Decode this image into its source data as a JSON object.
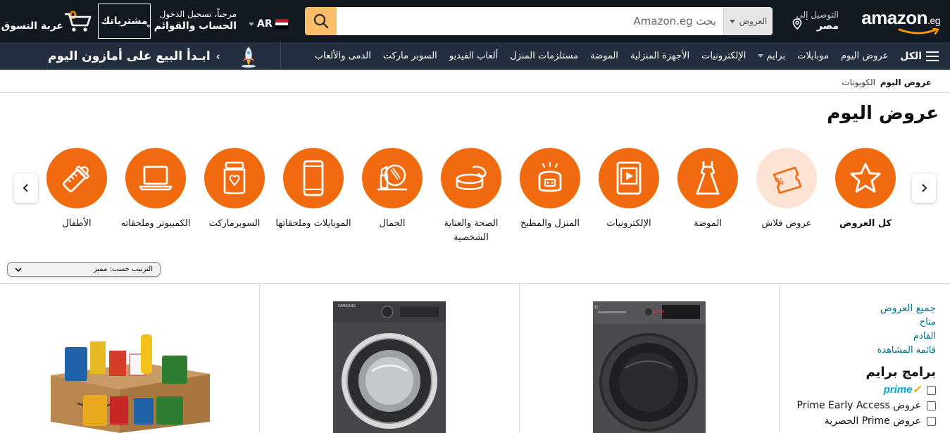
{
  "header": {
    "logo_text": "amazon",
    "logo_suffix": ".eg",
    "deliver_label": "التوصيل إلى",
    "deliver_location": "مصر",
    "search_category": "العروض",
    "search_placeholder": "بحث Amazon.eg",
    "language": "AR",
    "account_greeting": "مرحباً، تسجيل الدخول",
    "account_label": "الحساب والقوائم",
    "orders_label": "مشترياتك",
    "cart_count": "0",
    "cart_label": "عربة التسوق"
  },
  "subnav": {
    "all_label": "الكل",
    "items": [
      "عروض اليوم",
      "موبايلات",
      "برايم",
      "الإلكترونيات",
      "الأجهزة المنزلية",
      "الموضة",
      "مستلزمات المنزل",
      "ألعاب الفيديو",
      "السوبر ماركت",
      "الدمى والألعاب"
    ],
    "promo_text": "ابـدأ البيع على أمازون اليوم"
  },
  "breadcrumb": {
    "active": "عروض اليوم",
    "other": "الكوبونات"
  },
  "page_title": "عروض اليوم",
  "categories": [
    {
      "label": "كل العروض",
      "icon": "star-icon"
    },
    {
      "label": "عروض فلاش",
      "icon": "coupon-icon"
    },
    {
      "label": "الموضة",
      "icon": "dress-icon"
    },
    {
      "label": "الإلكترونيات",
      "icon": "tablet-play-icon"
    },
    {
      "label": "المنزل والمطبخ",
      "icon": "rice-cooker-icon"
    },
    {
      "label": "الصحة والعناية الشخصية",
      "icon": "cream-jar-icon"
    },
    {
      "label": "الجمال",
      "icon": "mirror-lipstick-icon"
    },
    {
      "label": "الموبايلات وملحقاتها",
      "icon": "phone-icon"
    },
    {
      "label": "السوبرماركت",
      "icon": "jar-icon"
    },
    {
      "label": "الكمبيوتر وملحقاته",
      "icon": "laptop-icon"
    },
    {
      "label": "الأطفال",
      "icon": "baby-bottle-icon"
    }
  ],
  "sort": {
    "label": "الترتيب حسب: مميز"
  },
  "filters": {
    "deal_links": [
      "جميع العروض",
      "متاح",
      "القادم",
      "قائمة المشاهدة"
    ],
    "prime_heading": "برامج برايم",
    "prime_logo": "prime",
    "prime_options": [
      "عروض Prime Early Access",
      "عروض Prime الحصرية"
    ]
  },
  "products": [
    {
      "name": "lg-washing-machine",
      "brand_mark": "LG"
    },
    {
      "name": "samsung-washing-machine",
      "brand_mark": "SAMSUNG"
    },
    {
      "name": "ramadan-grocery-box"
    }
  ],
  "colors": {
    "nav_dark": "#131921",
    "nav_sub": "#232f3e",
    "accent_orange": "#f26a10",
    "search_button": "#febd69",
    "link": "#007185"
  }
}
